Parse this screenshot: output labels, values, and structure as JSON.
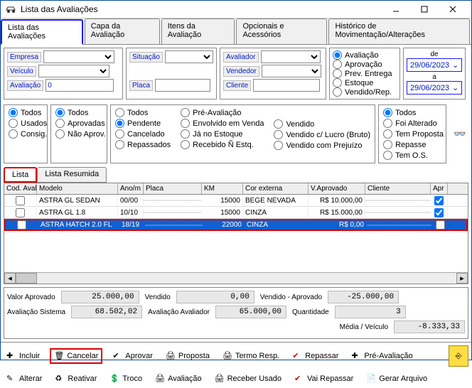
{
  "window": {
    "title": "Lista das Avaliações"
  },
  "tabs": {
    "t1": "Lista das Avaliações",
    "t2": "Capa da Avaliação",
    "t3": "Itens da Avaliação",
    "t4": "Opcionais e Acessórios",
    "t5": "Histórico de Movimentação/Alterações"
  },
  "filters": {
    "empresa": "Empresa",
    "situacao": "Situação",
    "avaliador": "Avaliador",
    "veiculo": "Veículo",
    "vendedor": "Vendedor",
    "avaliacao": "Avaliação",
    "avaliacao_val": "0",
    "placa": "Placa",
    "cliente": "Cliente",
    "r_avaliacao": "Avaliação",
    "r_aprovacao": "Aprovação",
    "r_preventrega": "Prev. Entrega",
    "r_estoque": "Estoque",
    "r_vendidorep": "Vendido/Rep.",
    "de": "de",
    "a": "a",
    "date1": "29/06/2023",
    "date2": "29/06/2023"
  },
  "rg1": {
    "todos": "Todos",
    "usados": "Usados",
    "consig": "Consig."
  },
  "rg2": {
    "todos": "Todos",
    "aprovadas": "Aprovadas",
    "naoaprov": "Não Aprov."
  },
  "rg3": {
    "todos": "Todos",
    "pendente": "Pendente",
    "cancelado": "Cancelado",
    "repassados": "Repassados",
    "preav": "Pré-Avaliação",
    "envvenda": "Envolvido em Venda",
    "jaestoque": "Já no Estoque",
    "recnestq": "Recebido Ñ Estq.",
    "vendido": "Vendido",
    "vendlucro": "Vendido c/ Lucro (Bruto)",
    "vendprej": "Vendido com Prejuízo"
  },
  "rg4": {
    "todos": "Todos",
    "foialt": "Foi Alterado",
    "temprop": "Tem Proposta",
    "repasse": "Repasse",
    "temos": "Tem O.S."
  },
  "subtabs": {
    "lista": "Lista",
    "resumida": "Lista Resumida"
  },
  "cols": {
    "cod": "Cod. Aval",
    "modelo": "Modelo",
    "ano": "Ano/m",
    "placa": "Placa",
    "km": "KM",
    "cor": "Cor externa",
    "vap": "V.Aprovado",
    "cli": "Cliente",
    "apr": "Apr"
  },
  "rows": [
    {
      "modelo": "ASTRA GL SEDAN",
      "ano": "00/00",
      "km": "15000",
      "cor": "BEGE NEVADA",
      "vap": "R$ 10.000,00",
      "apr": true
    },
    {
      "modelo": "ASTRA GL 1.8",
      "ano": "10/10",
      "km": "15000",
      "cor": "CINZA",
      "vap": "R$ 15.000,00",
      "apr": true
    },
    {
      "modelo": "ASTRA HATCH  2.0 FL",
      "ano": "18/19",
      "km": "22000",
      "cor": "CINZA",
      "vap": "R$ 0,00",
      "apr": false
    }
  ],
  "totals": {
    "vaprov": "Valor Aprovado",
    "vaprov_v": "25.000,00",
    "vendido": "Vendido",
    "vendido_v": "0,00",
    "vendaprov": "Vendido - Aprovado",
    "vendaprov_v": "-25.000,00",
    "avsis": "Avaliação Sistema",
    "avsis_v": "68.502,02",
    "avav": "Avaliação Avaliador",
    "avav_v": "65.000,00",
    "qtd": "Quantidade",
    "qtd_v": "3",
    "media": "Média / Veículo",
    "media_v": "-8.333,33"
  },
  "toolbar": {
    "incluir": "Incluir",
    "cancelar": "Cancelar",
    "aprovar": "Aprovar",
    "proposta": "Proposta",
    "termo": "Termo Resp.",
    "repassar": "Repassar",
    "preav": "Pré-Avaliação",
    "alterar": "Alterar",
    "reativar": "Reativar",
    "troco": "Troco",
    "avaliacao": "Avaliação",
    "recusado": "Receber Usado",
    "vairepassar": "Vai Repassar",
    "gerar": "Gerar Arquivo"
  }
}
